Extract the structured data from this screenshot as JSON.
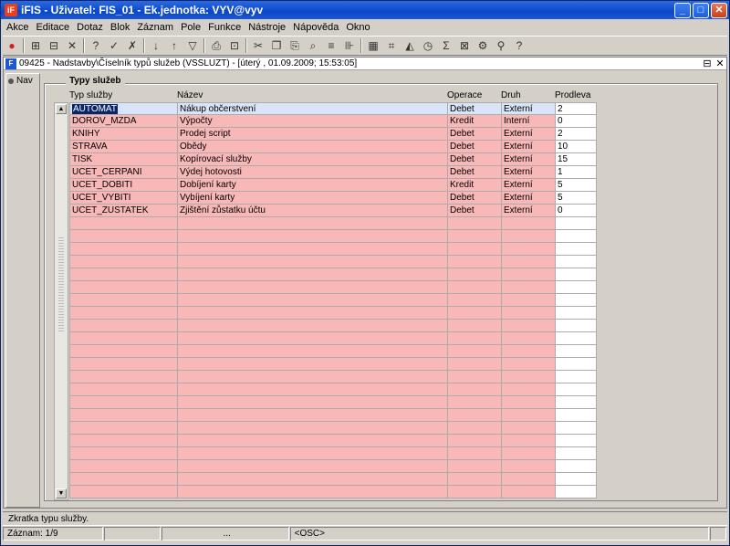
{
  "window": {
    "title": "iFIS - Uživatel: FIS_01 - Ek.jednotka: VYV@vyv",
    "icon_label": "iF"
  },
  "menu": [
    "Akce",
    "Editace",
    "Dotaz",
    "Blok",
    "Záznam",
    "Pole",
    "Funkce",
    "Nástroje",
    "Nápověda",
    "Okno"
  ],
  "toolbar": {
    "exit_label": "EXIT",
    "buttons": [
      {
        "name": "exit-icon",
        "glyph": "●"
      },
      {
        "sep": true
      },
      {
        "name": "insert-record-icon",
        "glyph": "⊞"
      },
      {
        "name": "save-icon",
        "glyph": "⊟"
      },
      {
        "name": "delete-record-icon",
        "glyph": "✕"
      },
      {
        "sep": true
      },
      {
        "name": "query-icon",
        "glyph": "?"
      },
      {
        "name": "execute-query-icon",
        "glyph": "✓"
      },
      {
        "name": "cancel-query-icon",
        "glyph": "✗"
      },
      {
        "sep": true
      },
      {
        "name": "sort-asc-icon",
        "glyph": "↓"
      },
      {
        "name": "sort-desc-icon",
        "glyph": "↑"
      },
      {
        "name": "filter-icon",
        "glyph": "▽"
      },
      {
        "sep": true
      },
      {
        "name": "print-icon",
        "glyph": "⎙"
      },
      {
        "name": "print-preview-icon",
        "glyph": "⊡"
      },
      {
        "sep": true
      },
      {
        "name": "cut-icon",
        "glyph": "✂"
      },
      {
        "name": "copy-icon",
        "glyph": "❐"
      },
      {
        "name": "paste-icon",
        "glyph": "⎘"
      },
      {
        "name": "zoom-icon",
        "glyph": "⌕"
      },
      {
        "name": "list-icon",
        "glyph": "≡"
      },
      {
        "name": "columns-icon",
        "glyph": "⊪"
      },
      {
        "sep": true
      },
      {
        "name": "calculator-icon",
        "glyph": "▦"
      },
      {
        "name": "tree-icon",
        "glyph": "⌗"
      },
      {
        "name": "chart-icon",
        "glyph": "◭"
      },
      {
        "name": "clock-icon",
        "glyph": "◷"
      },
      {
        "name": "sum-icon",
        "glyph": "Σ"
      },
      {
        "name": "excel-icon",
        "glyph": "⊠"
      },
      {
        "name": "settings-icon",
        "glyph": "⚙"
      },
      {
        "name": "users-icon",
        "glyph": "⚲"
      },
      {
        "name": "help-icon",
        "glyph": "?"
      }
    ]
  },
  "form": {
    "title": "09425 - Nadstavby\\Číselník typů služeb (VSSLUZT) - [úterý , 01.09.2009; 15:53:05]",
    "controls": [
      "⊟",
      "✕"
    ],
    "nav_label": "Nav",
    "frame_title": "Typy služeb",
    "columns": [
      "Typ služby",
      "Název",
      "Operace",
      "Druh",
      "Prodleva"
    ],
    "rows": [
      [
        "AUTOMAT",
        "Nákup občerstvení",
        "Debet",
        "Externí",
        "2"
      ],
      [
        "DOROV_MZDA",
        "Výpočty",
        "Kredit",
        "Interní",
        "0"
      ],
      [
        "KNIHY",
        "Prodej script",
        "Debet",
        "Externí",
        "2"
      ],
      [
        "STRAVA",
        "Obědy",
        "Debet",
        "Externí",
        "10"
      ],
      [
        "TISK",
        "Kopírovací služby",
        "Debet",
        "Externí",
        "15"
      ],
      [
        "UCET_CERPANI",
        "Výdej hotovosti",
        "Debet",
        "Externí",
        "1"
      ],
      [
        "UCET_DOBITI",
        "Dobíjení karty",
        "Kredit",
        "Externí",
        "5"
      ],
      [
        "UCET_VYBITI",
        "Vybíjení karty",
        "Debet",
        "Externí",
        "5"
      ],
      [
        "UCET_ZUSTATEK",
        "Zjištění zůstatku účtu",
        "Debet",
        "Externí",
        "0"
      ]
    ],
    "empty_rows": 22,
    "selected_row": 0
  },
  "status": {
    "hint": "Zkratka typu služby.",
    "record": "Záznam: 1/9",
    "dots": "...",
    "mode": "<OSC>"
  }
}
